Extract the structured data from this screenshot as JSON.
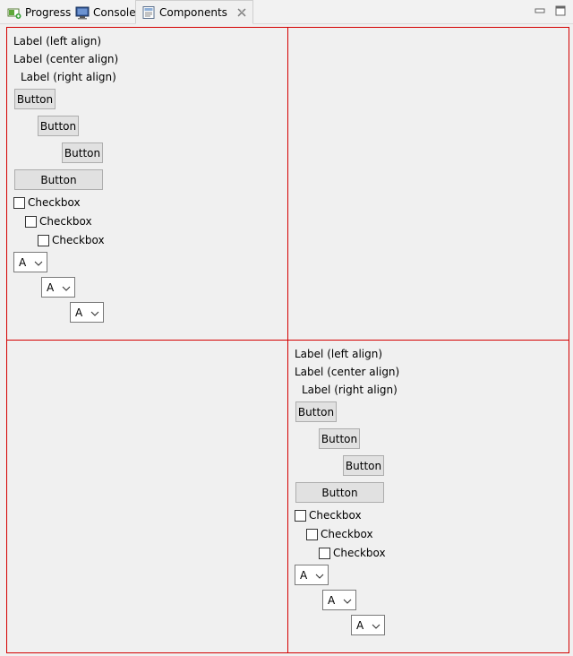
{
  "tabs": [
    {
      "label": "Progress",
      "icon": "progress-icon"
    },
    {
      "label": "Console",
      "icon": "console-icon"
    },
    {
      "label": "Components",
      "icon": "components-icon",
      "active": true
    }
  ],
  "view_controls": {
    "minimize_icon": "minimize-icon",
    "maximize_icon": "maximize-icon"
  },
  "colors": {
    "cell_border": "#d40000",
    "background": "#f0f0f0"
  },
  "panel": {
    "labels": [
      "Label (left align)",
      "Label (center align)",
      "Label (right align)"
    ],
    "buttons": [
      "Button",
      "Button",
      "Button",
      "Button"
    ],
    "checkboxes": [
      "Checkbox",
      "Checkbox",
      "Checkbox"
    ],
    "combos": [
      "A",
      "A",
      "A"
    ]
  }
}
